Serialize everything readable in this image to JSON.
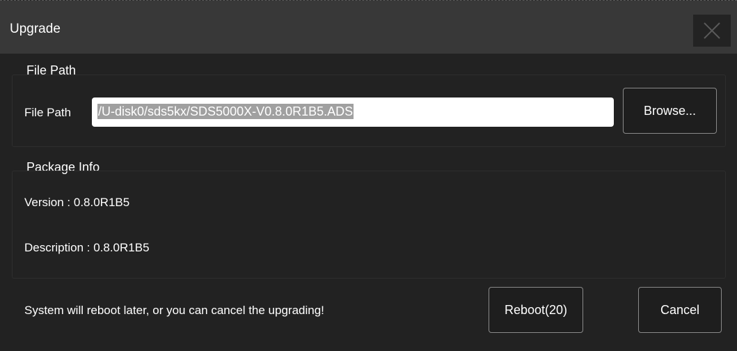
{
  "dialog": {
    "title": "Upgrade",
    "close_icon": "close-icon"
  },
  "file_path_group": {
    "heading": "File Path",
    "field_label": "File Path",
    "path_value": "/U-disk0/sds5kx/SDS5000X-V0.8.0R1B5.ADS",
    "browse_label": "Browse..."
  },
  "package_info_group": {
    "heading": "Package Info",
    "version_text": "Version : 0.8.0R1B5",
    "description_text": "Description : 0.8.0R1B5"
  },
  "footer": {
    "message": "System will reboot later, or you can cancel the upgrading!",
    "reboot_label": "Reboot(20)",
    "cancel_label": "Cancel"
  },
  "colors": {
    "titlebar": "#383838",
    "background": "#222222",
    "selection": "#a0a0a0"
  }
}
